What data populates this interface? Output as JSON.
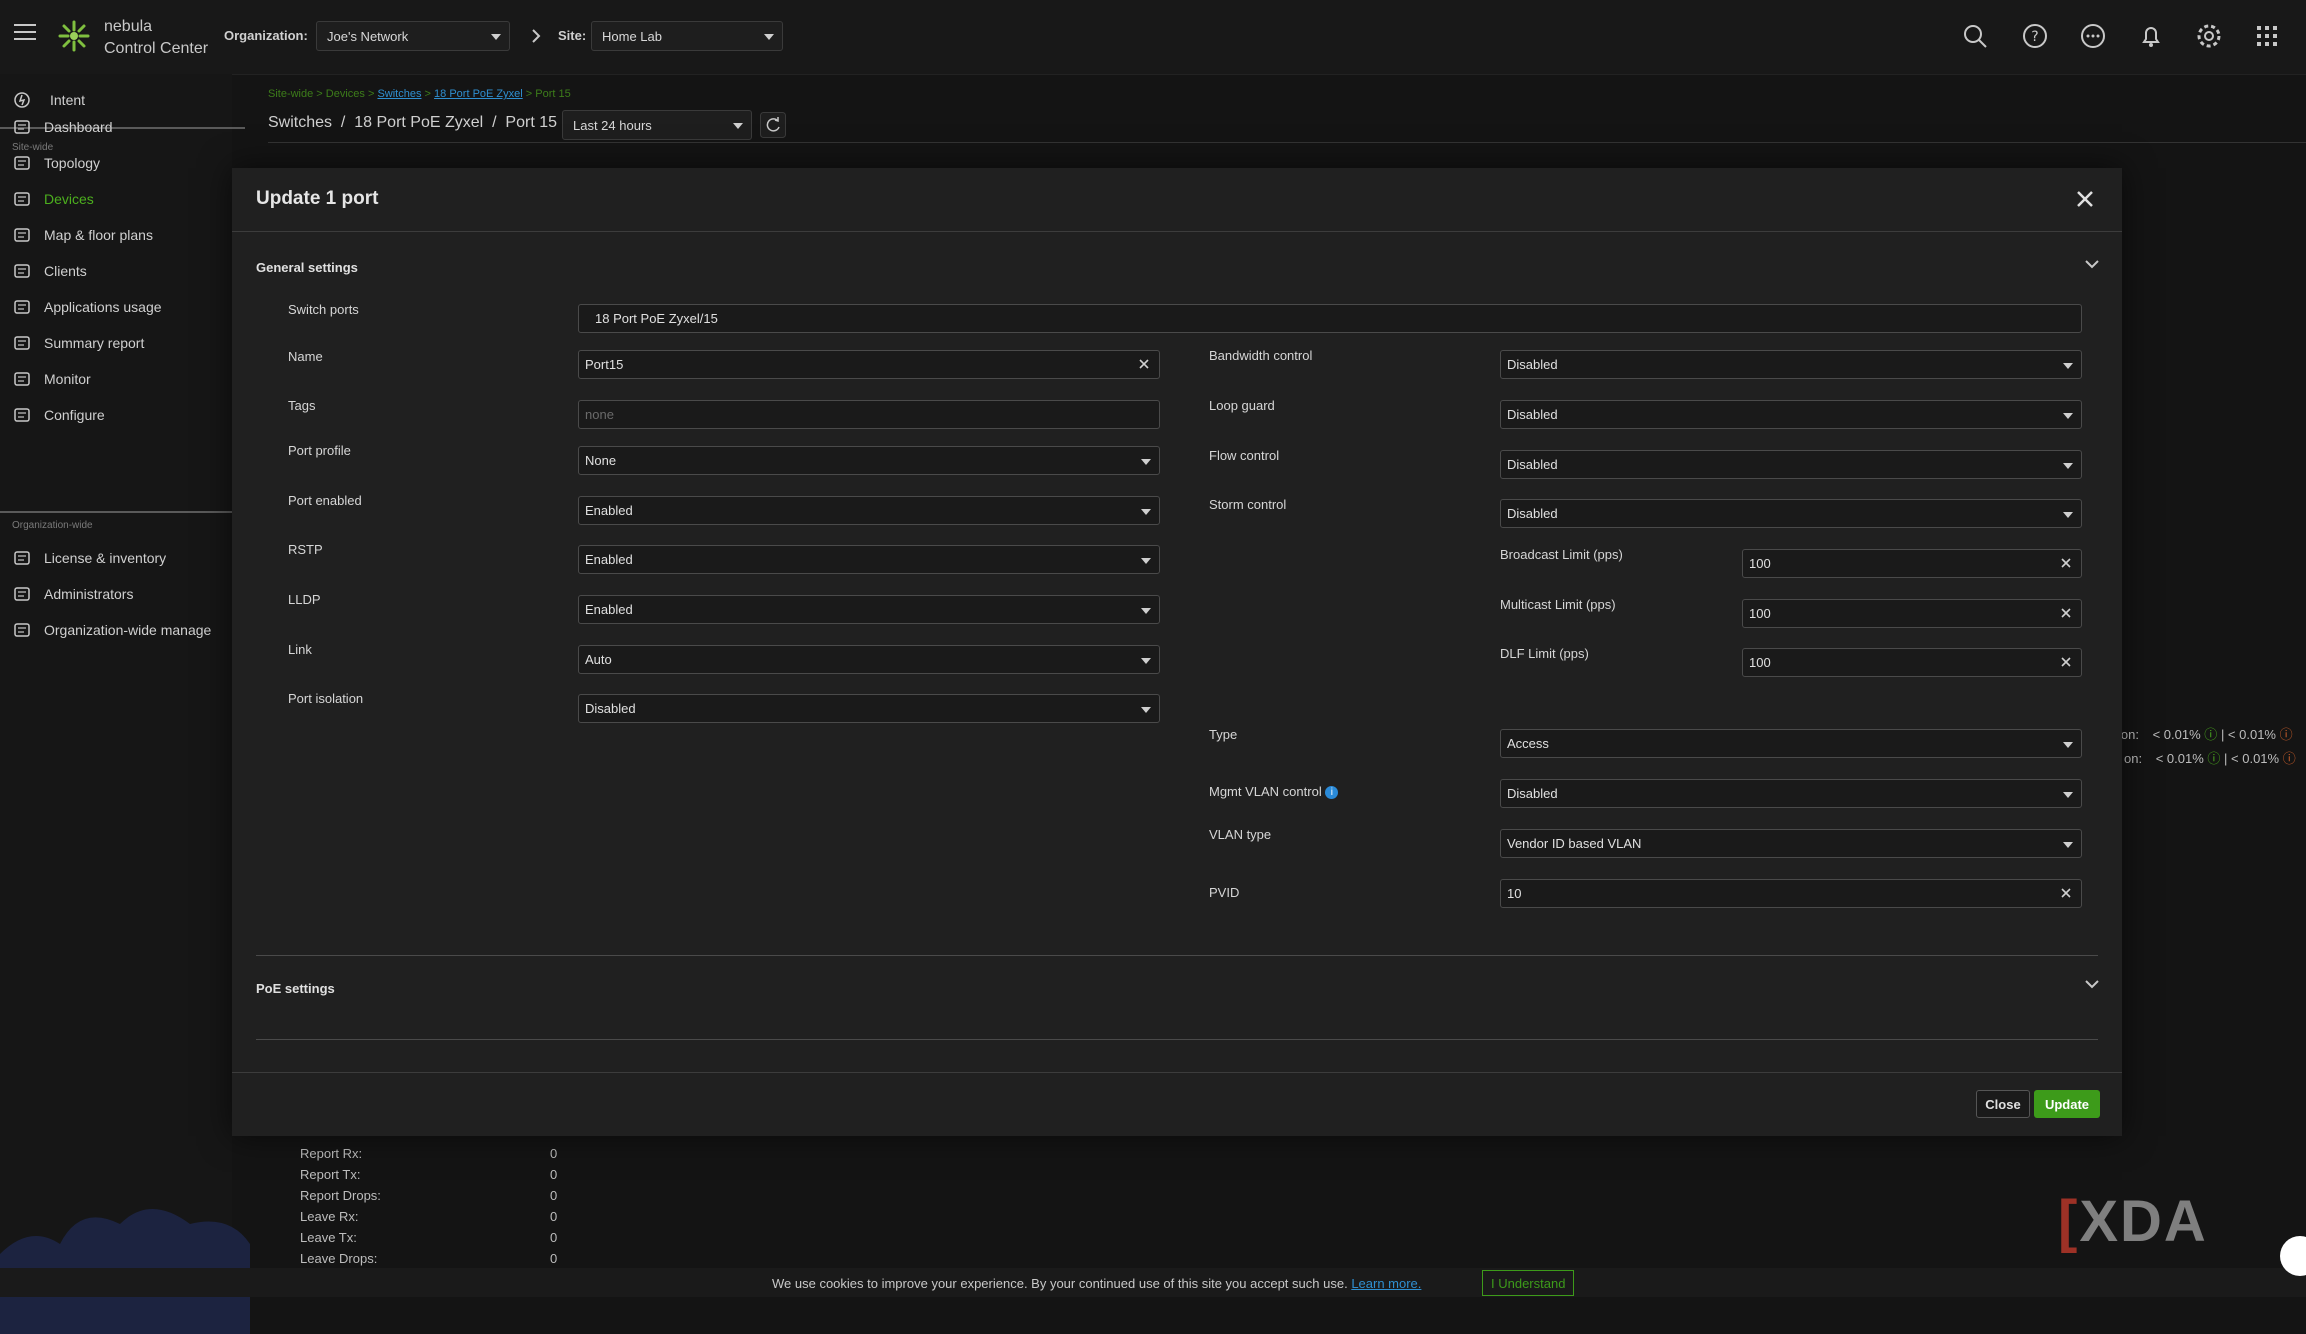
{
  "app": {
    "logo_line1": "nebula",
    "logo_line2": "Control Center"
  },
  "header": {
    "org_label": "Organization:",
    "org_value": "Joe's Network",
    "site_label": "Site:",
    "site_value": "Home Lab",
    "icons": [
      "search-icon",
      "help-icon",
      "chat-icon",
      "bell-icon",
      "gear-icon",
      "apps-grid-icon"
    ]
  },
  "sidebar": {
    "intent": "Intent",
    "site_section": "Site-wide",
    "items": [
      {
        "label": "Dashboard",
        "icon": "dashboard-icon"
      },
      {
        "label": "Topology",
        "icon": "topology-icon"
      },
      {
        "label": "Devices",
        "icon": "devices-icon"
      },
      {
        "label": "Map & floor plans",
        "icon": "map-icon"
      },
      {
        "label": "Clients",
        "icon": "clients-icon"
      },
      {
        "label": "Applications usage",
        "icon": "apps-usage-icon"
      },
      {
        "label": "Summary report",
        "icon": "report-icon"
      },
      {
        "label": "Monitor",
        "icon": "monitor-icon"
      },
      {
        "label": "Configure",
        "icon": "configure-icon"
      }
    ],
    "org_section": "Organization-wide",
    "org_items": [
      {
        "label": "License & inventory",
        "icon": "key-icon"
      },
      {
        "label": "Administrators",
        "icon": "admin-icon"
      },
      {
        "label": "Organization-wide manage",
        "icon": "building-icon"
      }
    ],
    "accent": "#4caf1e"
  },
  "page": {
    "breadcrumb_plain": "Site-wide > Devices >",
    "breadcrumb_switches": "Switches",
    "breadcrumb_sep": ">",
    "breadcrumb_device": "18 Port PoE Zyxel",
    "breadcrumb_port": "> Port 15",
    "title": "Switches  /  18 Port PoE Zyxel  /  Port 15",
    "range": "Last 24 hours",
    "stats": [
      {
        "label": "Report Rx:",
        "value": "0"
      },
      {
        "label": "Report Tx:",
        "value": "0"
      },
      {
        "label": "Report Drops:",
        "value": "0"
      },
      {
        "label": "Leave Rx:",
        "value": "0"
      },
      {
        "label": "Leave Tx:",
        "value": "0"
      },
      {
        "label": "Leave Drops:",
        "value": "0"
      }
    ],
    "side_text1": "ion:",
    "side_val1": "< 0.01%",
    "side_sep1": "| < 0.01%",
    "side_text2": "on:",
    "side_val2": "< 0.01%",
    "side_sep2": "| < 0.01%"
  },
  "modal": {
    "title": "Update 1 port",
    "general_settings": "General settings",
    "poe_settings": "PoE settings",
    "fields": {
      "switch_ports": {
        "label": "Switch ports",
        "value": "18 Port PoE Zyxel/15"
      },
      "name": {
        "label": "Name",
        "value": "Port15"
      },
      "tags": {
        "label": "Tags",
        "placeholder": "none"
      },
      "port_profile": {
        "label": "Port profile",
        "value": "None"
      },
      "port_enabled": {
        "label": "Port enabled",
        "value": "Enabled"
      },
      "rstp": {
        "label": "RSTP",
        "value": "Enabled"
      },
      "lldp": {
        "label": "LLDP",
        "value": "Enabled"
      },
      "link": {
        "label": "Link",
        "value": "Auto"
      },
      "port_isolation": {
        "label": "Port isolation",
        "value": "Disabled"
      },
      "bandwidth_control": {
        "label": "Bandwidth control",
        "value": "Disabled"
      },
      "loop_guard": {
        "label": "Loop guard",
        "value": "Disabled"
      },
      "flow_control": {
        "label": "Flow control",
        "value": "Disabled"
      },
      "storm_control": {
        "label": "Storm control",
        "value": "Disabled"
      },
      "broadcast_limit": {
        "label": "Broadcast Limit (pps)",
        "value": "100"
      },
      "multicast_limit": {
        "label": "Multicast Limit (pps)",
        "value": "100"
      },
      "dlf_limit": {
        "label": "DLF Limit (pps)",
        "value": "100"
      },
      "type": {
        "label": "Type",
        "value": "Access"
      },
      "mgmt_vlan_control": {
        "label": "Mgmt VLAN control",
        "value": "Disabled"
      },
      "vlan_type": {
        "label": "VLAN type",
        "value": "Vendor ID based VLAN"
      },
      "pvid": {
        "label": "PVID",
        "value": "10"
      }
    },
    "close_label": "Close",
    "update_label": "Update",
    "update_color": "#3d9b1a"
  },
  "cookie": {
    "text": "We use cookies to improve your experience. By your continued use of this site you accept such use.",
    "learn_more": "Learn more.",
    "accept": "I Understand"
  },
  "watermark": "XDA"
}
